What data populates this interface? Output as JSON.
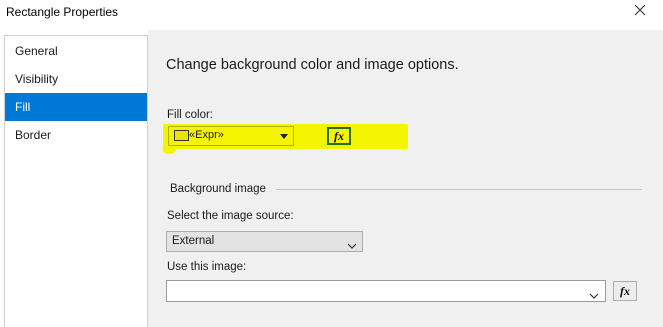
{
  "window": {
    "title": "Rectangle Properties"
  },
  "sidebar": {
    "items": [
      {
        "label": "General"
      },
      {
        "label": "Visibility"
      },
      {
        "label": "Fill"
      },
      {
        "label": "Border"
      }
    ],
    "selected": "Fill"
  },
  "main": {
    "heading": "Change background color and image options.",
    "fill_color": {
      "label": "Fill color:",
      "value": "«Expr»",
      "swatch_color": "#e6e600",
      "expression_button": "fx"
    },
    "background_image": {
      "group_label": "Background image",
      "source_label": "Select the image source:",
      "source_value": "External",
      "use_image_label": "Use this image:",
      "use_image_value": "",
      "expression_button": "fx"
    }
  },
  "colors": {
    "highlight": "#f4f400",
    "selection": "#0078d7",
    "panel_background": "#f0f0f0"
  }
}
